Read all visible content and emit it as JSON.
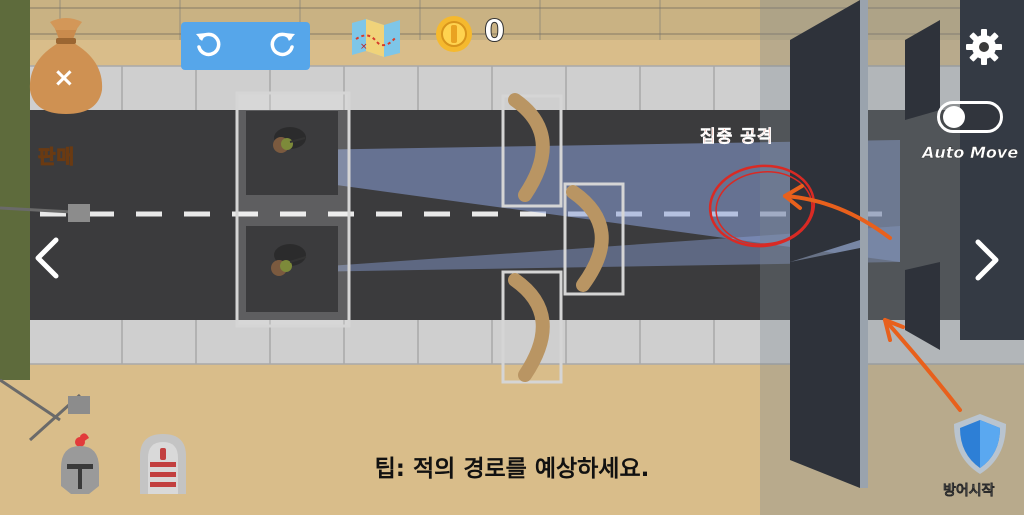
{
  "hud": {
    "sell_label": "판매",
    "coin_count": "0",
    "auto_move_label": "Auto Move",
    "auto_move_on": false,
    "defense_start_label": "방어시작",
    "tip_text": "팁: 적의 경로를 예상하세요.",
    "focus_attack_label": "집중 공격"
  },
  "icons": {
    "money_bag": "money-bag-icon",
    "close": "close-icon",
    "undo": "undo-icon",
    "redo": "redo-icon",
    "map": "treasure-map-icon",
    "coin": "gold-coin-icon",
    "settings": "gear-icon",
    "prev": "chevron-left-icon",
    "next": "chevron-right-icon",
    "knight": "knight-helmet-icon",
    "gate": "gate-icon",
    "shield": "shield-icon"
  },
  "colors": {
    "road": "#3b3b3d",
    "sand": "#d9bd8a",
    "sidewalk": "#c9c9c9",
    "beam": "#7f93c8",
    "accent_blue": "#56a6ea",
    "focus_red": "#d92a24",
    "hint_orange": "#e8601c"
  }
}
